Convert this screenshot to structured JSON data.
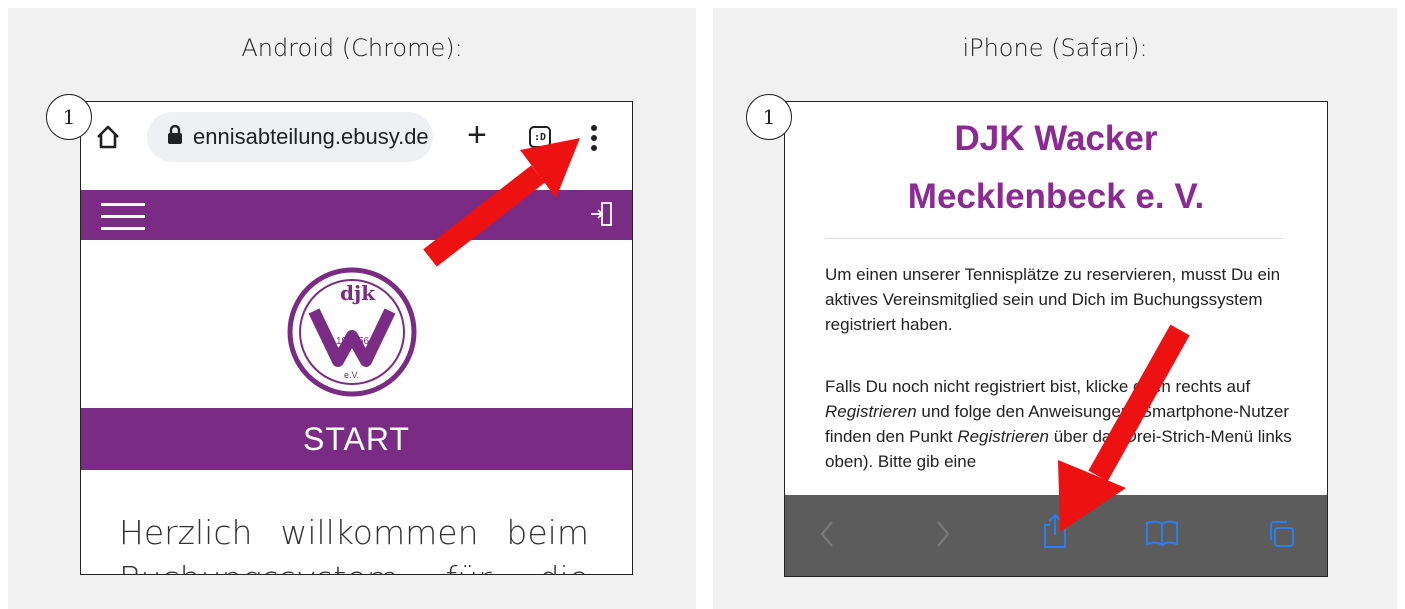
{
  "panels": {
    "android": {
      "title": "Android (Chrome):",
      "step": "1"
    },
    "iphone": {
      "title": "iPhone (Safari):",
      "step": "1"
    }
  },
  "android": {
    "url": "ennisabteilung.ebusy.de",
    "tab_count_label": ":D",
    "start_label": "START",
    "welcome_line1": "Herzlich willkommen beim",
    "welcome_line2": "Buchungssystem für die",
    "logo_year_left": "19",
    "logo_year_right": "56",
    "logo_text": "e.V.",
    "brand_color": "#7a2b84"
  },
  "iphone": {
    "title_line1": "DJK Wacker",
    "title_line2": "Mecklenbeck e. V.",
    "paragraph1": "Um einen unserer Tennisplätze zu reservieren, musst Du ein aktives Vereinsmitglied sein und Dich im Buchungssystem registriert haben.",
    "paragraph2_parts": [
      "Falls Du noch nicht registriert bist, klicke oben rechts auf ",
      "Registrieren",
      " und folge den Anweisungen (Smartphone-Nutzer finden den Punkt ",
      "Registrieren",
      " über das Drei-Strich-Menü links oben). Bitte gib eine"
    ],
    "title_color": "#8b2a93",
    "toolbar_color": "#5c5c5c",
    "accent_color": "#2b7ef0"
  },
  "annotations": {
    "arrow_color": "#ee1111"
  }
}
